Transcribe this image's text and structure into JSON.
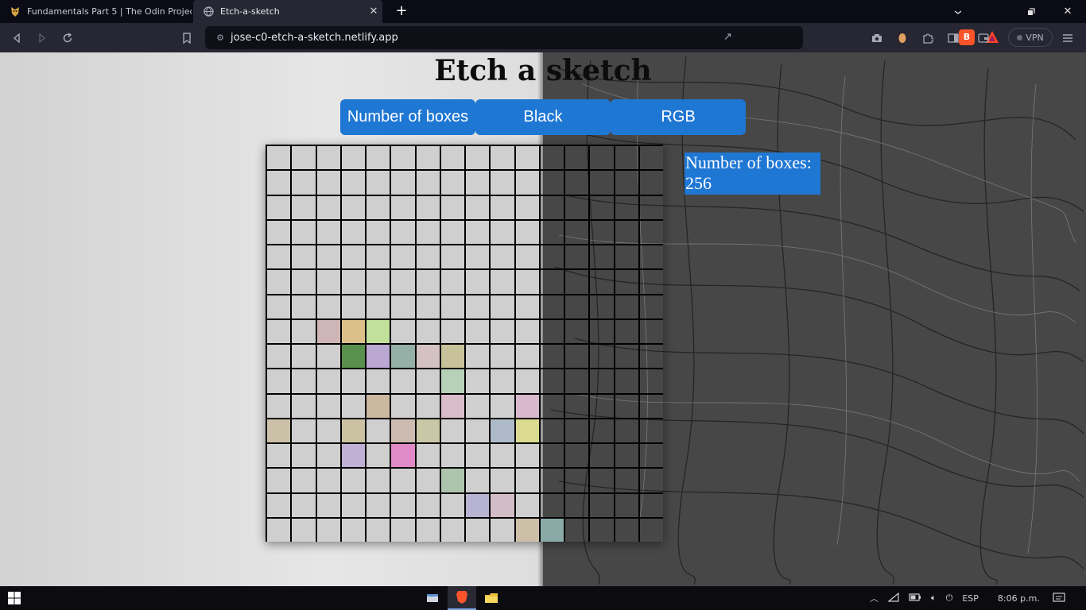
{
  "browser": {
    "tabs": [
      {
        "title": "Fundamentals Part 5 | The Odin Project",
        "icon": "odin-icon"
      },
      {
        "title": "Etch-a-sketch",
        "icon": "globe-icon",
        "active": true
      }
    ],
    "url": "jose-c0-etch-a-sketch.netlify.app",
    "vpn_label": "VPN"
  },
  "app": {
    "title": "Etch a sketch",
    "buttons": {
      "boxes": "Number of boxes",
      "black": "Black",
      "rgb": "RGB"
    },
    "counter_text": "Number of boxes: 256",
    "accent": "#1f77d4",
    "grid": {
      "rows": 16,
      "cols": 16,
      "painted": [
        {
          "r": 7,
          "c": 2,
          "color": "#cfb6b6"
        },
        {
          "r": 7,
          "c": 3,
          "color": "#dcc08a"
        },
        {
          "r": 7,
          "c": 4,
          "color": "#c2e09a"
        },
        {
          "r": 8,
          "c": 3,
          "color": "#5a904e"
        },
        {
          "r": 8,
          "c": 4,
          "color": "#bba8d2"
        },
        {
          "r": 8,
          "c": 5,
          "color": "#95b0a6"
        },
        {
          "r": 8,
          "c": 6,
          "color": "#d4c2c2"
        },
        {
          "r": 8,
          "c": 7,
          "color": "#c8c29a"
        },
        {
          "r": 9,
          "c": 7,
          "color": "#b7d0b8"
        },
        {
          "r": 10,
          "c": 4,
          "color": "#cbb89f"
        },
        {
          "r": 10,
          "c": 7,
          "color": "#d8bcca"
        },
        {
          "r": 10,
          "c": 10,
          "color": "#d8b8cc"
        },
        {
          "r": 11,
          "c": 0,
          "color": "#cbc0a8"
        },
        {
          "r": 11,
          "c": 3,
          "color": "#cbc2a2"
        },
        {
          "r": 11,
          "c": 5,
          "color": "#cdbab0"
        },
        {
          "r": 11,
          "c": 6,
          "color": "#c8c8a6"
        },
        {
          "r": 11,
          "c": 9,
          "color": "#aebac8"
        },
        {
          "r": 11,
          "c": 10,
          "color": "#dada90"
        },
        {
          "r": 12,
          "c": 3,
          "color": "#bfb0d4"
        },
        {
          "r": 12,
          "c": 5,
          "color": "#e08ac8"
        },
        {
          "r": 13,
          "c": 7,
          "color": "#adc4ac"
        },
        {
          "r": 14,
          "c": 8,
          "color": "#b6b4d0"
        },
        {
          "r": 14,
          "c": 9,
          "color": "#d2bcc6"
        },
        {
          "r": 15,
          "c": 10,
          "color": "#cdc0a8"
        },
        {
          "r": 15,
          "c": 11,
          "color": "#8aaaa8"
        }
      ]
    }
  },
  "taskbar": {
    "lang": "ESP",
    "time": "8:06 p.m."
  }
}
